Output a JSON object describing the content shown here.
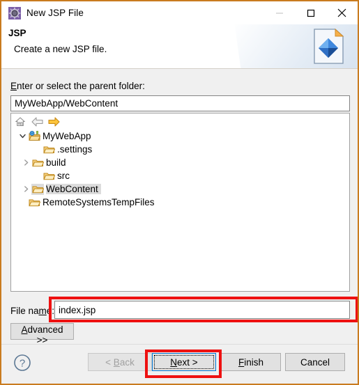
{
  "window": {
    "title": "New JSP File",
    "icon": "jsp-wizard-icon",
    "controls": {
      "minimize": "minimize-icon",
      "maximize": "maximize-icon",
      "close": "close-icon"
    }
  },
  "header": {
    "title": "JSP",
    "description": "Create a new JSP file.",
    "icon": "jsp-file-banner-icon"
  },
  "form": {
    "parent_folder_label": "Enter or select the parent folder:",
    "parent_folder_value": "MyWebApp/WebContent",
    "parent_folder_placeholder": "",
    "file_name_label": "File name:",
    "file_name_value": "index.jsp",
    "file_name_placeholder": "",
    "advanced_label": "Advanced >>"
  },
  "tree": {
    "toolbar": [
      {
        "name": "home-icon",
        "label": "Home"
      },
      {
        "name": "back-arrow-icon",
        "label": "Back"
      },
      {
        "name": "forward-arrow-icon",
        "label": "Forward"
      }
    ],
    "items": [
      {
        "label": "MyWebApp",
        "indent": 0,
        "twisty": "expanded",
        "icon": "project-folder-icon",
        "selected": false
      },
      {
        "label": ".settings",
        "indent": 1,
        "twisty": "none",
        "icon": "folder-icon",
        "selected": false
      },
      {
        "label": "build",
        "indent": 1,
        "twisty": "collapsed",
        "icon": "folder-icon",
        "selected": false
      },
      {
        "label": "src",
        "indent": 1,
        "twisty": "none",
        "icon": "folder-icon",
        "selected": false
      },
      {
        "label": "WebContent",
        "indent": 1,
        "twisty": "collapsed",
        "icon": "folder-icon",
        "selected": true
      },
      {
        "label": "RemoteSystemsTempFiles",
        "indent": 0,
        "twisty": "none",
        "icon": "folder-icon",
        "selected": false
      }
    ]
  },
  "footer": {
    "help": "help-icon",
    "buttons": {
      "back": "< Back",
      "next": "Next >",
      "finish": "Finish",
      "cancel": "Cancel"
    }
  },
  "annotations": {
    "color": "#ee1111",
    "boxes": [
      "file-name-field",
      "next-button"
    ]
  }
}
